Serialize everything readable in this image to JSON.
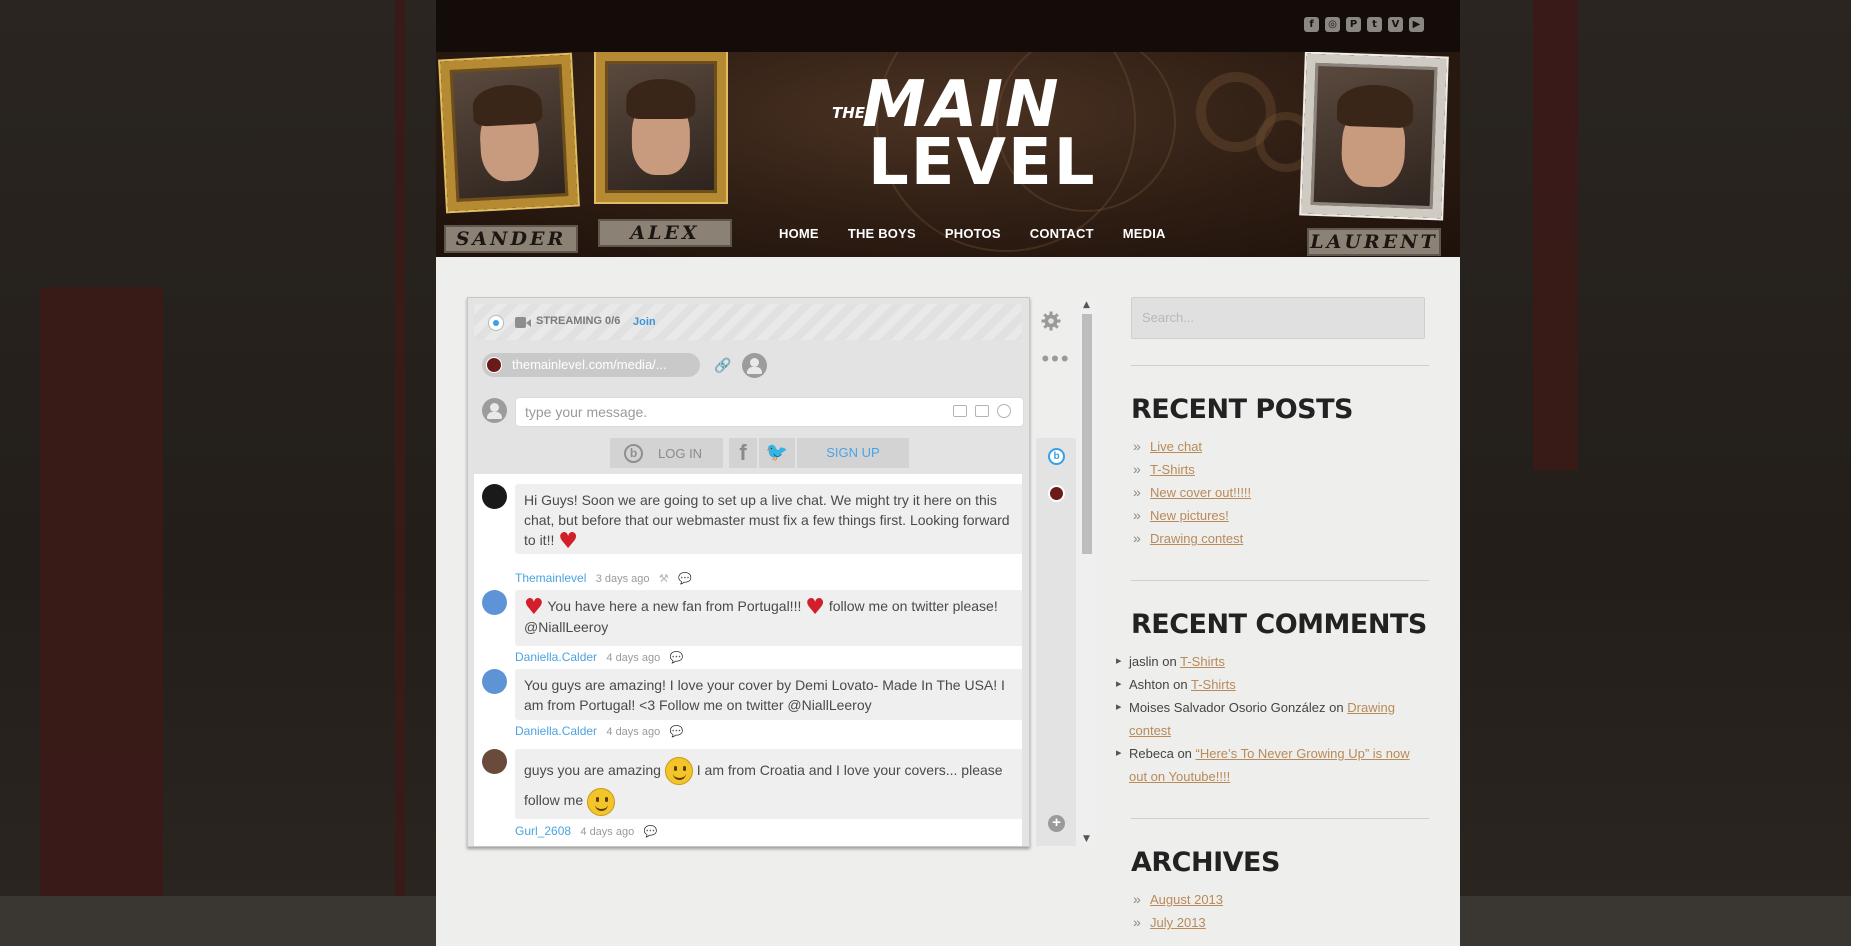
{
  "social": [
    "f",
    "◎",
    "P",
    "t",
    "V",
    "▶"
  ],
  "brand": {
    "the": "THE",
    "main": "MAIN",
    "level": "LEVEL"
  },
  "banner_names": [
    "SANDER",
    "ALEX",
    "LAURENT"
  ],
  "nav": [
    "HOME",
    "THE BOYS",
    "PHOTOS",
    "CONTACT",
    "MEDIA"
  ],
  "chat": {
    "streaming": "STREAMING 0/6",
    "join": "Join",
    "url": "themainlevel.com/media/...",
    "input_placeholder": "type your message.",
    "login": "LOG IN",
    "signup": "SIGN UP",
    "b_letter": "b",
    "facebook": "f",
    "twitter": "🐦",
    "messages": [
      {
        "text_a": "Hi Guys! Soon we are going to set up a live chat. We might try it here on this chat, but before that our webmaster must fix a few things first. Looking forward to it!!",
        "author": "Themainlevel",
        "time": "3 days ago"
      },
      {
        "text_a": "You have here a new fan from Portugal!!!",
        "text_b": "follow me on twitter please! @NiallLeeroy",
        "author": "Daniella.Calder",
        "time": "4 days ago"
      },
      {
        "text_a": "You guys are amazing! I love your cover by Demi Lovato- Made In The USA! I am from Portugal! <3 Follow me on twitter @NiallLeeroy",
        "author": "Daniella.Calder",
        "time": "4 days ago"
      },
      {
        "text_a": "guys you are amazing",
        "text_b": "I am from Croatia and I love your covers... please follow me",
        "author": "Gurl_2608",
        "time": "4 days ago"
      }
    ]
  },
  "sidebar": {
    "search_placeholder": "Search...",
    "recent_posts_title": "RECENT POSTS",
    "recent_posts": [
      "Live chat",
      "T-Shirts",
      "New cover out!!!!!",
      "New pictures!",
      "Drawing contest"
    ],
    "recent_comments_title": "RECENT COMMENTS",
    "recent_comments": [
      {
        "who": "jaslin",
        "on": "on",
        "post": "T-Shirts"
      },
      {
        "who": "Ashton",
        "on": "on",
        "post": "T-Shirts"
      },
      {
        "who": "Moises Salvador Osorio González",
        "on": "on",
        "post": "Drawing contest"
      },
      {
        "who": "Rebeca",
        "on": "on",
        "post": "“Here’s To Never Growing Up” is now out on Youtube!!!!"
      }
    ],
    "archives_title": "ARCHIVES",
    "archives": [
      "August 2013",
      "July 2013"
    ]
  },
  "colors": {
    "link": "#b98a5a",
    "chat_author": "#4ba3df",
    "heart": "#d21f2a"
  }
}
